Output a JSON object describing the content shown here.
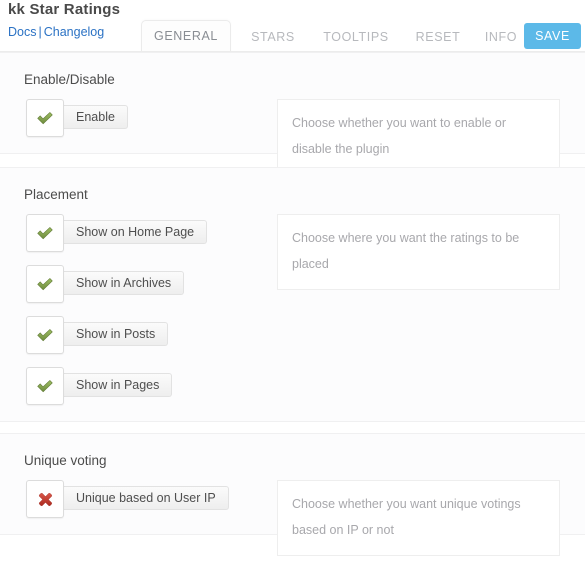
{
  "header": {
    "title": "kk Star Ratings",
    "links": [
      {
        "label": "Docs"
      },
      {
        "label": "Changelog"
      }
    ],
    "separator": "|",
    "tabs": [
      {
        "id": "general",
        "label": "GENERAL",
        "active": true
      },
      {
        "id": "stars",
        "label": "STARS",
        "active": false
      },
      {
        "id": "tooltips",
        "label": "TOOLTIPS",
        "active": false
      },
      {
        "id": "reset",
        "label": "RESET",
        "active": false
      },
      {
        "id": "info",
        "label": "INFO",
        "active": false
      }
    ],
    "save_label": "SAVE",
    "accent_color": "#5cb9e8",
    "link_color": "#2b72c4"
  },
  "sections": [
    {
      "id": "enable-disable",
      "title": "Enable/Disable",
      "options": [
        {
          "label": "Enable",
          "state": "on",
          "icon": "check-icon"
        }
      ],
      "description": "Choose whether you want to enable or disable the plugin"
    },
    {
      "id": "placement",
      "title": "Placement",
      "options": [
        {
          "label": "Show on Home Page",
          "state": "on",
          "icon": "check-icon"
        },
        {
          "label": "Show in Archives",
          "state": "on",
          "icon": "check-icon"
        },
        {
          "label": "Show in Posts",
          "state": "on",
          "icon": "check-icon"
        },
        {
          "label": "Show in Pages",
          "state": "on",
          "icon": "check-icon"
        }
      ],
      "description": "Choose where you want the ratings to be placed"
    },
    {
      "id": "unique-voting",
      "title": "Unique voting",
      "options": [
        {
          "label": "Unique based on User IP",
          "state": "off",
          "icon": "cross-icon"
        }
      ],
      "description": "Choose whether you want unique votings based on IP or not"
    }
  ],
  "colors": {
    "check_green": "#7a9c46",
    "cross_red": "#c9362c",
    "page_bg": "#ffffff",
    "section_bg": "#fcfcfd"
  }
}
